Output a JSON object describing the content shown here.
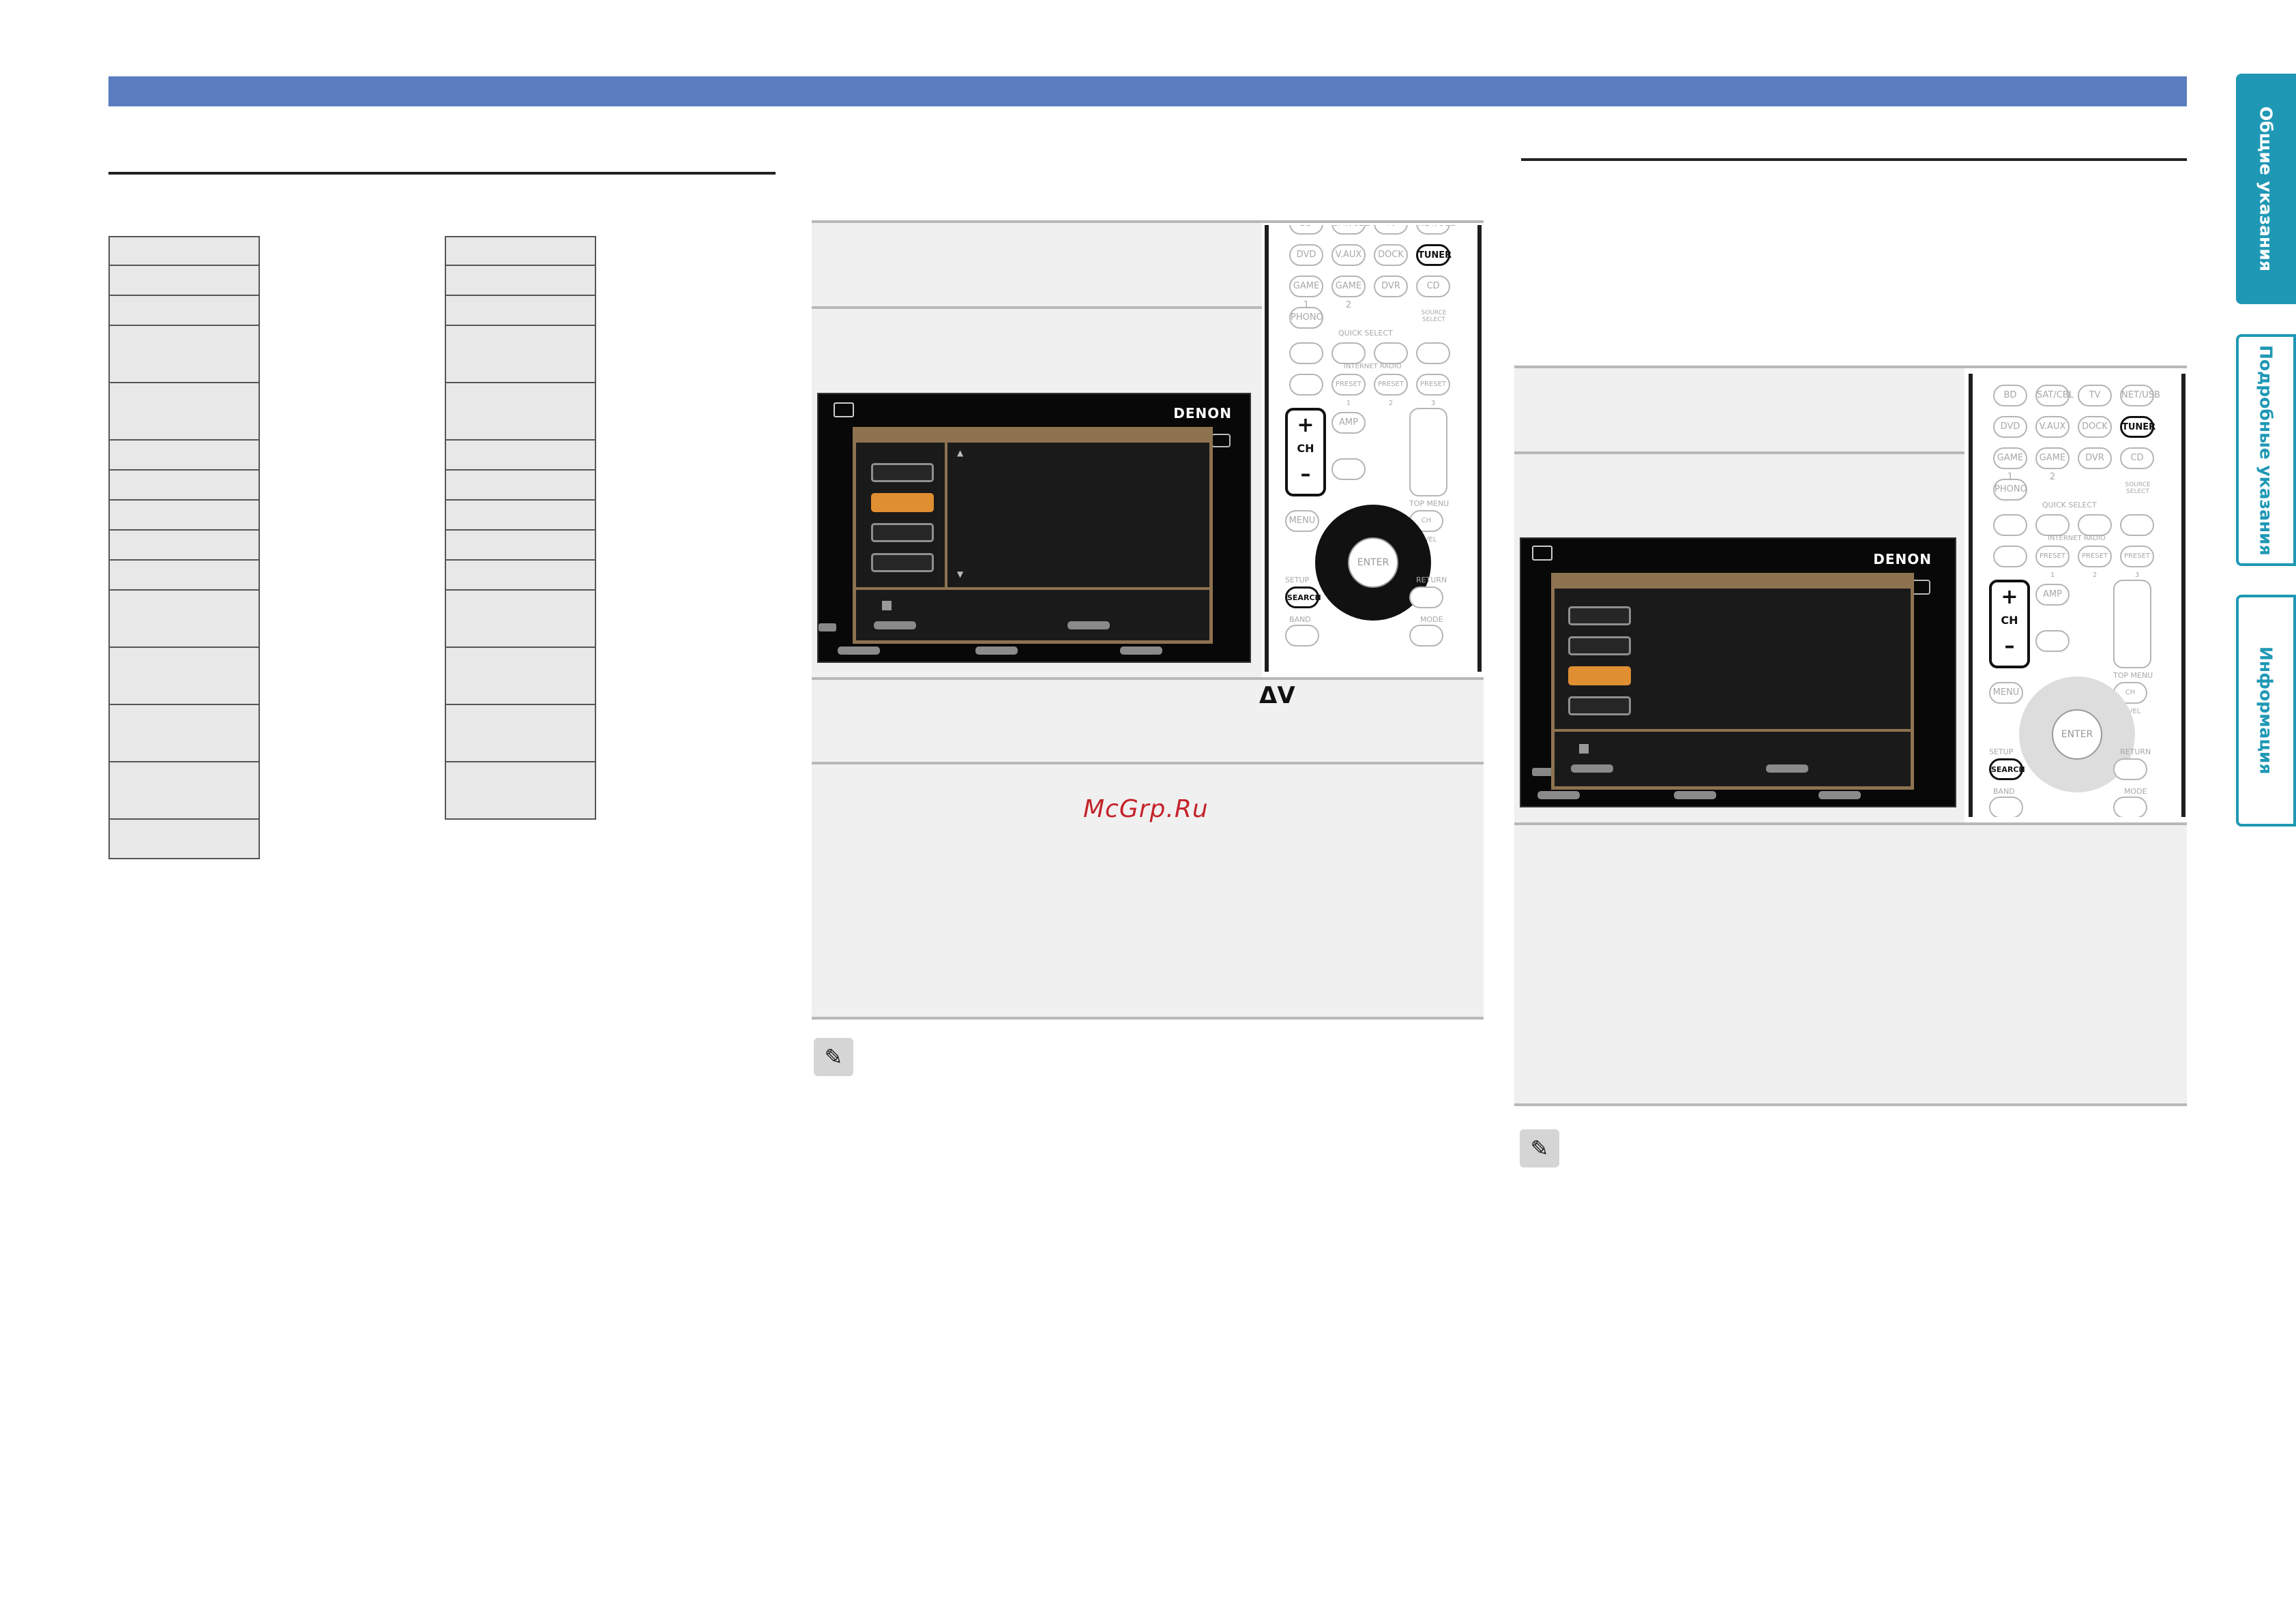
{
  "watermark": "McGrp.Ru",
  "arrow_symbols": "ΔV",
  "screen": {
    "brand": "DENON"
  },
  "tabs": [
    "Общие указания",
    "Подробные указания",
    "Информация"
  ],
  "remote": {
    "keys_row1": [
      "BD",
      "SAT/CBL",
      "TV",
      "NET/USB"
    ],
    "keys_row2": [
      "DVD",
      "V.AUX",
      "DOCK",
      "TUNER"
    ],
    "keys_row3": [
      "GAME 1",
      "GAME 2",
      "DVR",
      "CD"
    ],
    "phono": "PHONO",
    "source_select": "SOURCE SELECT",
    "quick_select": "QUICK SELECT",
    "internet_radio": "INTERNET RADIO",
    "presets": [
      "PRESET 1",
      "PRESET 2",
      "PRESET 3"
    ],
    "ch": "CH",
    "amp": "AMP",
    "menu": "MENU",
    "top_menu": "TOP MENU",
    "ch_level": "CH LEVEL",
    "enter": "ENTER",
    "setup": "SETUP",
    "search": "SEARCH",
    "return": "RETURN",
    "band": "BAND",
    "mode": "MODE",
    "plus": "+",
    "minus": "–"
  }
}
